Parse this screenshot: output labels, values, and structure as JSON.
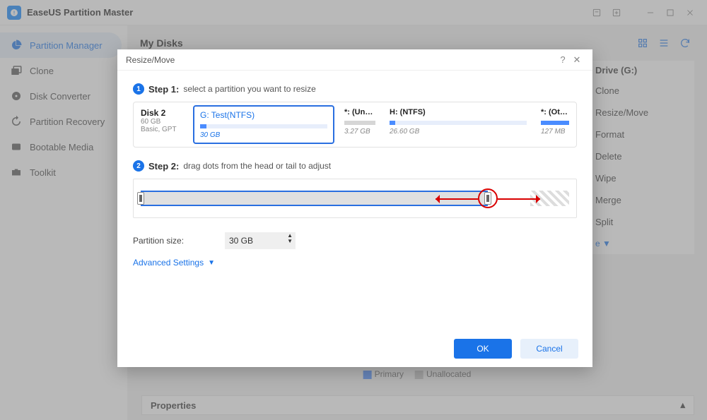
{
  "window": {
    "title": "EaseUS Partition Master"
  },
  "sidebar": {
    "items": [
      {
        "label": "Partition Manager",
        "active": true
      },
      {
        "label": "Clone"
      },
      {
        "label": "Disk Converter"
      },
      {
        "label": "Partition Recovery"
      },
      {
        "label": "Bootable Media"
      },
      {
        "label": "Toolkit"
      }
    ]
  },
  "content": {
    "header": "My Disks",
    "legend": {
      "primary": "Primary",
      "unalloc": "Unallocated"
    },
    "properties": "Properties"
  },
  "context_panel": {
    "drive": "Drive (G:)",
    "items": [
      "Clone",
      "Resize/Move",
      "Format",
      "Delete",
      "Wipe",
      "Merge",
      "Split"
    ],
    "more": "e  ▼"
  },
  "modal": {
    "title": "Resize/Move",
    "step1_label": "Step 1:",
    "step1_desc": "select a partition you want to resize",
    "disk": {
      "name": "Disk 2",
      "size": "60 GB",
      "type": "Basic, GPT"
    },
    "partitions": [
      {
        "name": "G: Test(NTFS)",
        "size": "30 GB",
        "fill": 5,
        "selected": true
      },
      {
        "name": "*: (Unallo…",
        "size": "3.27 GB",
        "fill": 0
      },
      {
        "name": "H: (NTFS)",
        "size": "26.60 GB",
        "fill": 4
      },
      {
        "name": "*: (Oth…",
        "size": "127 MB",
        "fill": 100
      }
    ],
    "step2_label": "Step 2:",
    "step2_desc": "drag dots from the head or tail to adjust",
    "partition_size_label": "Partition size:",
    "partition_size_value": "30 GB",
    "advanced": "Advanced Settings",
    "ok": "OK",
    "cancel": "Cancel"
  }
}
